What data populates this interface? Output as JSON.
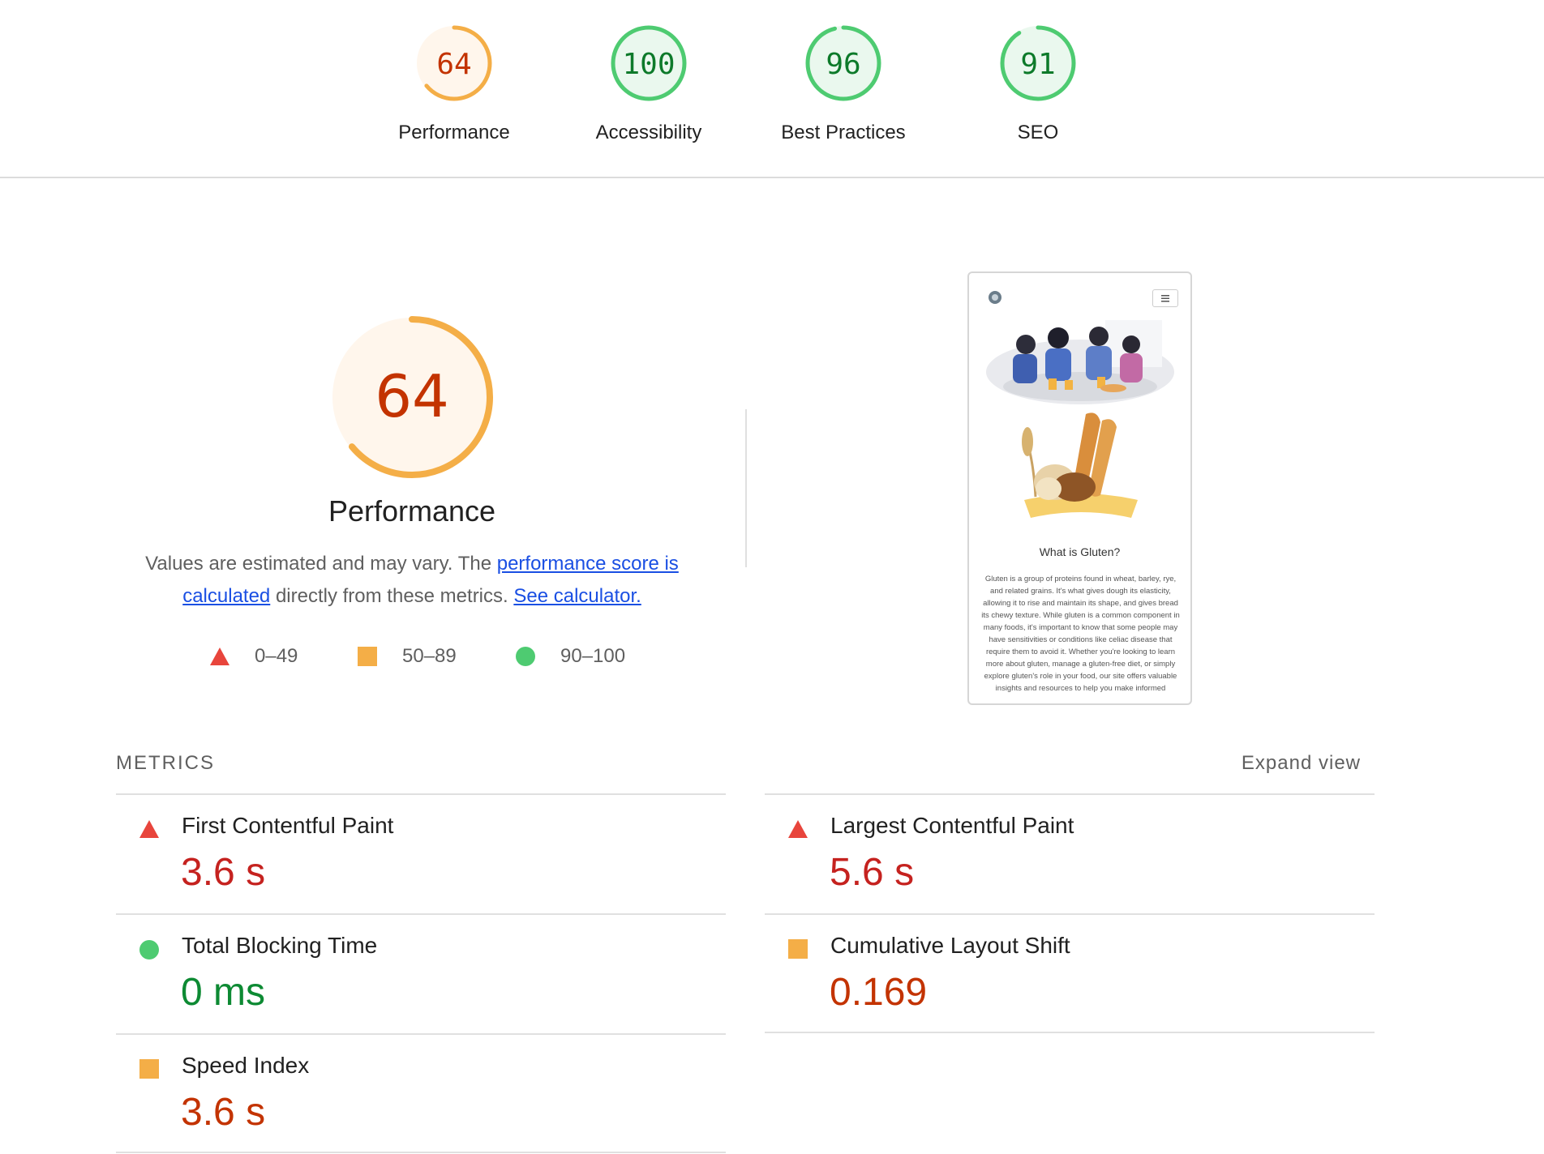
{
  "scores": [
    {
      "value": "64",
      "label": "Performance",
      "score": 0.64,
      "rating": "average"
    },
    {
      "value": "100",
      "label": "Accessibility",
      "score": 1.0,
      "rating": "pass"
    },
    {
      "value": "96",
      "label": "Best Practices",
      "score": 0.96,
      "rating": "pass"
    },
    {
      "value": "91",
      "label": "SEO",
      "score": 0.91,
      "rating": "pass"
    }
  ],
  "performance": {
    "score": "64",
    "title": "Performance",
    "desc_prefix": "Values are estimated and may vary. The ",
    "link_score": "performance score is calculated",
    "desc_mid": " directly from these metrics. ",
    "link_calc": "See calculator."
  },
  "legend": [
    {
      "range": "0–49",
      "icon": "triangle-icon",
      "color": "#e8453c"
    },
    {
      "range": "50–89",
      "icon": "square-icon",
      "color": "#f4ae47"
    },
    {
      "range": "90–100",
      "icon": "circle-icon",
      "color": "#4ecb71"
    }
  ],
  "screenshot": {
    "heading": "What is Gluten?",
    "body": "Gluten is a group of proteins found in wheat, barley, rye, and related grains. It's what gives dough its elasticity, allowing it to rise and maintain its shape, and gives bread its chewy texture. While gluten is a common component in many foods, it's important to know that some people may have sensitivities or conditions like celiac disease that require them to avoid it. Whether you're looking to learn more about gluten, manage a gluten-free diet, or simply explore gluten's role in your food, our site offers valuable insights and resources to help you make informed"
  },
  "metrics": {
    "header": "METRICS",
    "expand_label": "Expand view",
    "items": [
      {
        "name": "First Contentful Paint",
        "value": "3.6 s",
        "rating": "fail"
      },
      {
        "name": "Largest Contentful Paint",
        "value": "5.6 s",
        "rating": "fail"
      },
      {
        "name": "Total Blocking Time",
        "value": "0 ms",
        "rating": "pass"
      },
      {
        "name": "Cumulative Layout Shift",
        "value": "0.169",
        "rating": "average"
      },
      {
        "name": "Speed Index",
        "value": "3.6 s",
        "rating": "average"
      }
    ]
  },
  "colors": {
    "fail": "#e8453c",
    "average": "#f4ae47",
    "pass": "#4ecb71",
    "average_bg": "#fff6ec",
    "pass_bg": "#eaf8ee",
    "link": "#1a4fe3"
  }
}
